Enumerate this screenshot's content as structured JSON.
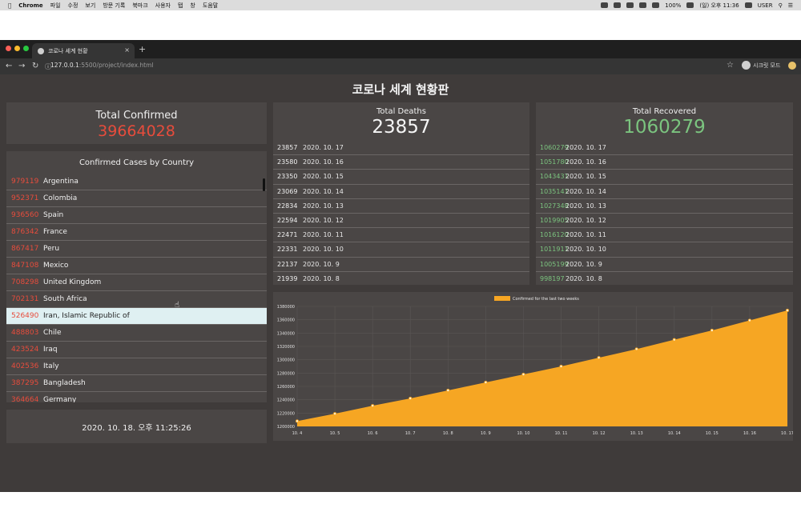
{
  "menubar": {
    "app": "Chrome",
    "items": [
      "파일",
      "수정",
      "보기",
      "방문 기록",
      "북마크",
      "사용자",
      "탭",
      "창",
      "도움말"
    ],
    "battery": "100%",
    "clock": "(일) 오후 11:36",
    "user": "USER"
  },
  "browser": {
    "tab_title": "코로나 세계 현황",
    "tab_close": "×",
    "new_tab": "+",
    "url_host": "127.0.0.1",
    "url_rest": ":5500/project/index.html",
    "incognito_label": "시크릿 모드"
  },
  "page": {
    "title": "코로나 세계 현황판",
    "total_confirmed_label": "Total Confirmed",
    "total_confirmed_value": "39664028",
    "country_panel_title": "Confirmed Cases by Country",
    "countries": [
      {
        "count": "979119",
        "name": "Argentina"
      },
      {
        "count": "952371",
        "name": "Colombia"
      },
      {
        "count": "936560",
        "name": "Spain"
      },
      {
        "count": "876342",
        "name": "France"
      },
      {
        "count": "867417",
        "name": "Peru"
      },
      {
        "count": "847108",
        "name": "Mexico"
      },
      {
        "count": "708298",
        "name": "United Kingdom"
      },
      {
        "count": "702131",
        "name": "South Africa"
      },
      {
        "count": "526490",
        "name": "Iran, Islamic Republic of"
      },
      {
        "count": "488803",
        "name": "Chile"
      },
      {
        "count": "423524",
        "name": "Iraq"
      },
      {
        "count": "402536",
        "name": "Italy"
      },
      {
        "count": "387295",
        "name": "Bangladesh"
      },
      {
        "count": "364664",
        "name": "Germany"
      }
    ],
    "highlighted_country_index": 8,
    "timestamp": "2020. 10. 18. 오후 11:25:26",
    "deaths_label": "Total Deaths",
    "deaths_value": "23857",
    "deaths_list": [
      {
        "count": "23857",
        "date": "2020. 10. 17"
      },
      {
        "count": "23580",
        "date": "2020. 10. 16"
      },
      {
        "count": "23350",
        "date": "2020. 10. 15"
      },
      {
        "count": "23069",
        "date": "2020. 10. 14"
      },
      {
        "count": "22834",
        "date": "2020. 10. 13"
      },
      {
        "count": "22594",
        "date": "2020. 10. 12"
      },
      {
        "count": "22471",
        "date": "2020. 10. 11"
      },
      {
        "count": "22331",
        "date": "2020. 10. 10"
      },
      {
        "count": "22137",
        "date": "2020. 10. 9"
      },
      {
        "count": "21939",
        "date": "2020. 10. 8"
      }
    ],
    "recovered_label": "Total Recovered",
    "recovered_value": "1060279",
    "recovered_list": [
      {
        "count": "1060279",
        "date": "2020. 10. 17"
      },
      {
        "count": "1051780",
        "date": "2020. 10. 16"
      },
      {
        "count": "1043431",
        "date": "2020. 10. 15"
      },
      {
        "count": "1035141",
        "date": "2020. 10. 14"
      },
      {
        "count": "1027348",
        "date": "2020. 10. 13"
      },
      {
        "count": "1019905",
        "date": "2020. 10. 12"
      },
      {
        "count": "1016120",
        "date": "2020. 10. 11"
      },
      {
        "count": "1011911",
        "date": "2020. 10. 10"
      },
      {
        "count": "1005199",
        "date": "2020. 10. 9"
      },
      {
        "count": "998197",
        "date": "2020. 10. 8"
      }
    ]
  },
  "colors": {
    "confirmed": "#e74c3c",
    "recovered": "#7bc47f",
    "area": "#f6a623",
    "background": "#3f3b3a",
    "panel": "#4a4645"
  },
  "chart_data": {
    "type": "area",
    "legend": "Confirmed for the last two weeks",
    "legend_position": "top-center",
    "x": [
      "10. 4",
      "10. 5",
      "10. 6",
      "10. 7",
      "10. 8",
      "10. 9",
      "10. 10",
      "10. 11",
      "10. 12",
      "10. 13",
      "10. 14",
      "10. 15",
      "10. 16",
      "10. 17"
    ],
    "values": [
      1208000,
      1219000,
      1231000,
      1242000,
      1254000,
      1266000,
      1278000,
      1290000,
      1303000,
      1316000,
      1330000,
      1344000,
      1359000,
      1374000
    ],
    "yticks": [
      1200000,
      1220000,
      1240000,
      1260000,
      1280000,
      1300000,
      1320000,
      1340000,
      1360000,
      1380000
    ],
    "ylim": [
      1200000,
      1380000
    ],
    "grid": true
  }
}
